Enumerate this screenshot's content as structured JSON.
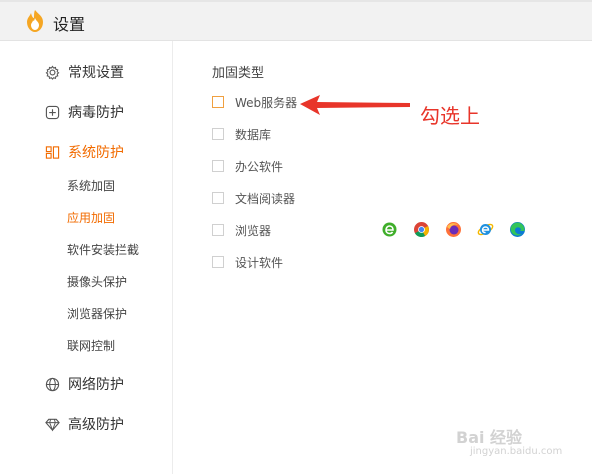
{
  "window": {
    "title": "设置"
  },
  "sidebar": {
    "items": [
      {
        "label": "常规设置",
        "icon": "gear-icon"
      },
      {
        "label": "病毒防护",
        "icon": "plus-box-icon"
      },
      {
        "label": "系统防护",
        "icon": "system-grid-icon",
        "active": true
      },
      {
        "label": "网络防护",
        "icon": "globe-icon"
      },
      {
        "label": "高级防护",
        "icon": "diamond-icon"
      }
    ],
    "sub_items": [
      {
        "label": "系统加固"
      },
      {
        "label": "应用加固",
        "active": true
      },
      {
        "label": "软件安装拦截"
      },
      {
        "label": "摄像头保护"
      },
      {
        "label": "浏览器保护"
      },
      {
        "label": "联网控制"
      }
    ]
  },
  "main": {
    "section_title": "加固类型",
    "options": [
      {
        "label": "Web服务器",
        "checked": false
      },
      {
        "label": "数据库",
        "checked": false
      },
      {
        "label": "办公软件",
        "checked": false
      },
      {
        "label": "文档阅读器",
        "checked": false
      },
      {
        "label": "浏览器",
        "checked": false
      },
      {
        "label": "设计软件",
        "checked": false
      }
    ],
    "browser_icons": [
      "ie-green-icon",
      "chrome-icon",
      "firefox-icon",
      "ie-blue-icon",
      "edge-icon"
    ]
  },
  "annotation": {
    "text": "勾选上",
    "color": "#e8352a"
  },
  "watermark": {
    "text": "Bai 经验",
    "sub": "jingyan.baidu.com"
  },
  "colors": {
    "accent": "#f26b00",
    "annotation": "#e8352a"
  }
}
